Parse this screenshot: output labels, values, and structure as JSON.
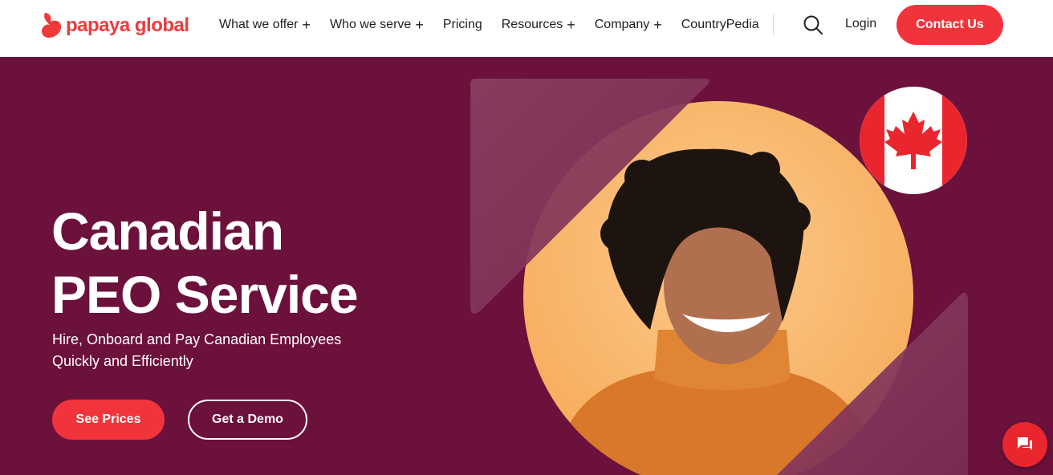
{
  "brand": {
    "name": "papaya global",
    "color": "#f03a3a"
  },
  "nav": {
    "items": [
      {
        "label": "What we offer",
        "has_submenu": true
      },
      {
        "label": "Who we serve",
        "has_submenu": true
      },
      {
        "label": "Pricing",
        "has_submenu": false
      },
      {
        "label": "Resources",
        "has_submenu": true
      },
      {
        "label": "Company",
        "has_submenu": true
      },
      {
        "label": "CountryPedia",
        "has_submenu": false
      }
    ],
    "submenu_glyph": "+",
    "login_label": "Login",
    "contact_label": "Contact Us"
  },
  "hero": {
    "title_line1": "Canadian",
    "title_line2": "PEO Service",
    "subtitle_line1": "Hire, Onboard and Pay Canadian Employees",
    "subtitle_line2": "Quickly and Efficiently",
    "primary_cta": "See Prices",
    "secondary_cta": "Get a Demo",
    "background_color": "#6b113c",
    "accent_color": "#f1343b"
  },
  "icons": {
    "search": "search-icon",
    "chat": "chat-icon",
    "flag": "canada-flag-icon"
  }
}
